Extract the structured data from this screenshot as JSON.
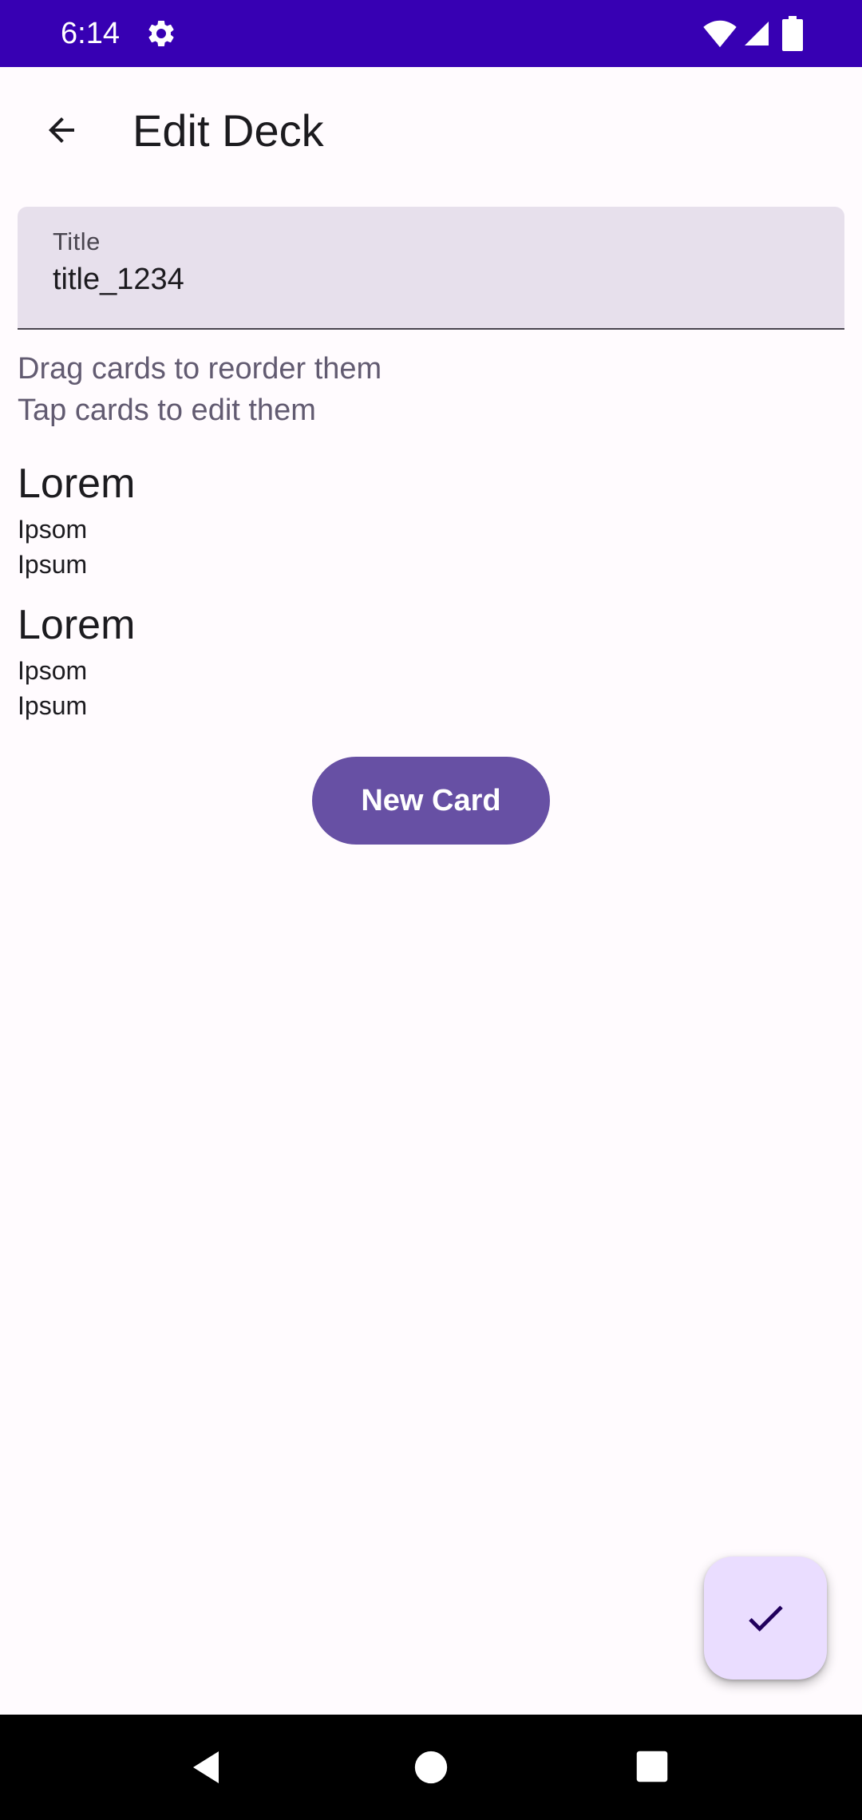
{
  "status_bar": {
    "time": "6:14",
    "icons": [
      "gear-icon",
      "wifi-icon",
      "signal-icon",
      "battery-icon"
    ],
    "background": "#3700b3"
  },
  "app_bar": {
    "title": "Edit Deck",
    "back_icon": "arrow-back-icon"
  },
  "title_field": {
    "label": "Title",
    "value": "title_1234"
  },
  "hints": {
    "line1": "Drag cards to reorder them",
    "line2": "Tap cards to edit them"
  },
  "cards": [
    {
      "title": "Lorem",
      "front": "Ipsom",
      "back": "Ipsum"
    },
    {
      "title": "Lorem",
      "front": "Ipsom",
      "back": "Ipsum"
    }
  ],
  "new_card_button": {
    "label": "New Card",
    "color": "#6750a4"
  },
  "fab": {
    "icon": "check-icon",
    "color": "#eaddff"
  },
  "nav_bar": {
    "icons": [
      "nav-back-icon",
      "nav-home-icon",
      "nav-recents-icon"
    ]
  }
}
